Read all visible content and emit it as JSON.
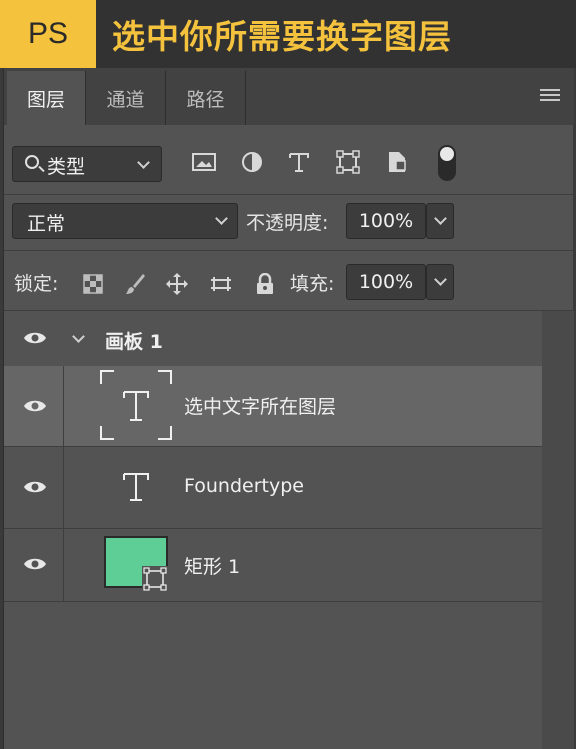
{
  "banner": {
    "badge": "PS",
    "title": "选中你所需要换字图层",
    "badge_color": "#f4c23c"
  },
  "tabs": [
    {
      "label": "图层",
      "active": true
    },
    {
      "label": "通道",
      "active": false
    },
    {
      "label": "路径",
      "active": false
    }
  ],
  "filter": {
    "type_label": "类型",
    "icons": [
      "image-filter-icon",
      "adjustment-filter-icon",
      "type-filter-icon",
      "shape-filter-icon",
      "smart-object-filter-icon"
    ],
    "toggle_on": true
  },
  "blend": {
    "mode": "正常",
    "opacity_label": "不透明度:",
    "opacity_value": "100%"
  },
  "lock": {
    "label": "锁定:",
    "icons": [
      "lock-transparency-icon",
      "lock-pixels-icon",
      "lock-position-icon",
      "lock-artboard-icon",
      "lock-all-icon"
    ],
    "fill_label": "填充:",
    "fill_value": "100%"
  },
  "layers": {
    "group": {
      "name": "画板 1",
      "expanded": true
    },
    "items": [
      {
        "name": "选中文字所在图层",
        "kind": "text",
        "selected": true
      },
      {
        "name": "Foundertype",
        "kind": "text",
        "selected": false
      },
      {
        "name": "矩形 1",
        "kind": "shape",
        "selected": false,
        "thumb_color": "#5fce96"
      }
    ]
  }
}
